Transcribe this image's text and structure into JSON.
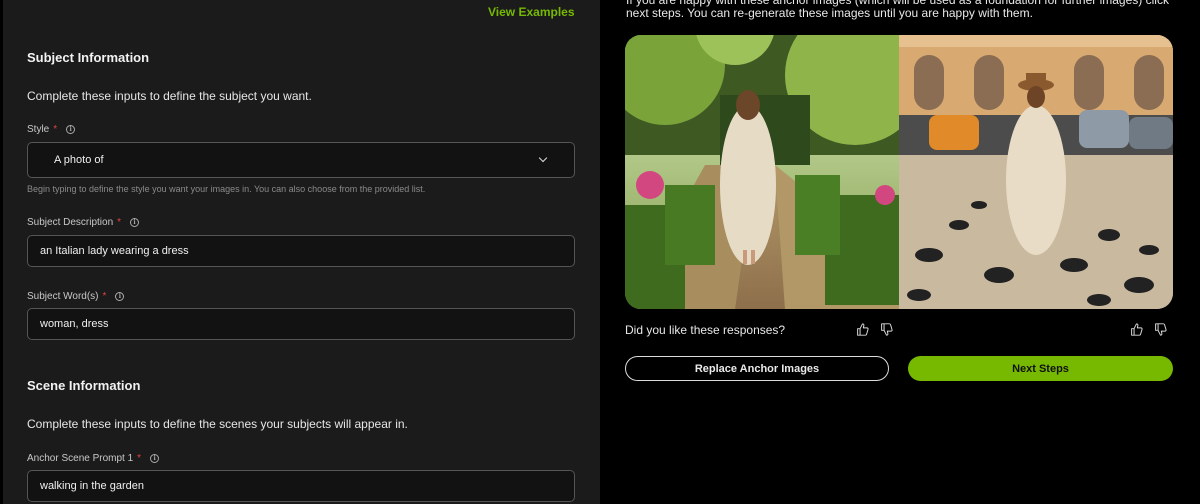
{
  "left": {
    "view_examples": "View Examples",
    "subject": {
      "title": "Subject Information",
      "description": "Complete these inputs to define the subject you want.",
      "style_label": "Style",
      "style_value": "A photo of",
      "style_helper": "Begin typing to define the style you want your images in. You can also choose from the provided list.",
      "description_label": "Subject Description",
      "description_value": "an Italian lady wearing a dress",
      "words_label": "Subject Word(s)",
      "words_value": "woman, dress"
    },
    "scene": {
      "title": "Scene Information",
      "description": "Complete these inputs to define the scenes your subjects will appear in.",
      "anchor_label": "Anchor Scene Prompt 1",
      "anchor_value": "walking in the garden"
    },
    "required_marker": "*",
    "info_glyph": "i"
  },
  "right": {
    "intro_text": "If you are happy with these anchor images (which will be used as a foundation for further images) click next steps. You can re-generate these images until you are happy with them.",
    "feedback_question": "Did you like these responses?",
    "replace_button": "Replace Anchor Images",
    "next_button": "Next Steps"
  },
  "colors": {
    "accent": "#76b900",
    "required": "#e0433f"
  }
}
